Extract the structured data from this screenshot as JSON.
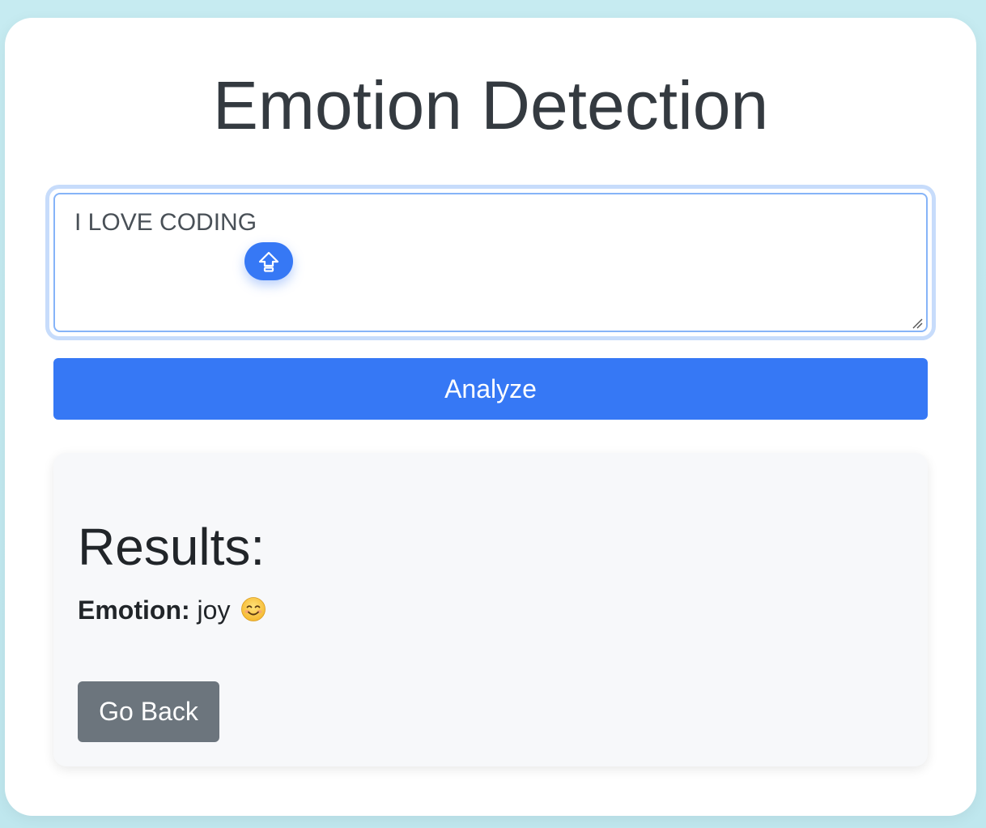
{
  "page": {
    "title": "Emotion Detection"
  },
  "input": {
    "value": "I LOVE CODING",
    "float_button_icon": "upload-arrow-icon"
  },
  "actions": {
    "analyze_label": "Analyze",
    "back_label": "Go Back"
  },
  "results": {
    "heading": "Results:",
    "emotion_label": "Emotion:",
    "emotion_value": "joy",
    "emotion_icon": "smiling-face-emoji"
  },
  "colors": {
    "primary": "#3678f5",
    "secondary": "#6c757d",
    "title_text": "#343a40",
    "results_bg": "#f7f8fa",
    "page_bg": "#c6ebf1"
  }
}
